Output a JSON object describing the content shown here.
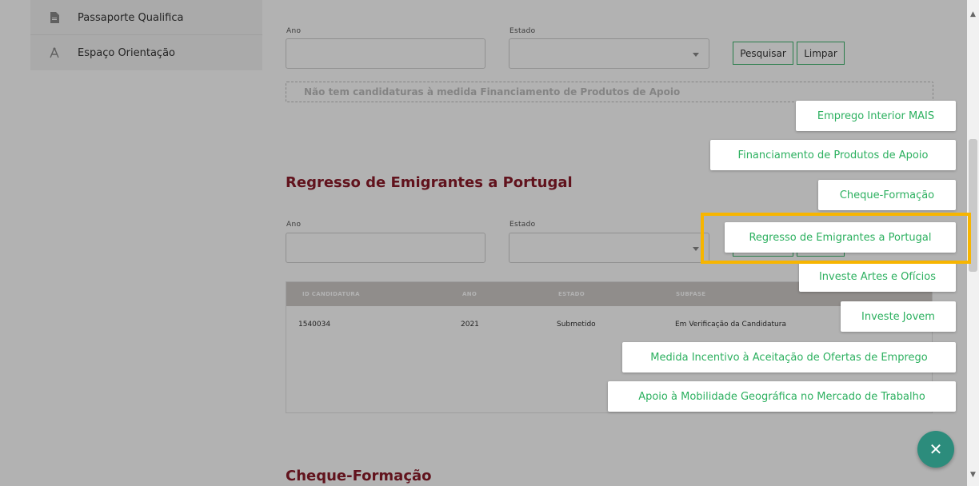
{
  "sidebar": {
    "items": [
      {
        "label": "Passaporte Qualifica",
        "icon": "document-icon"
      },
      {
        "label": "Espaço Orientação",
        "icon": "compass-icon"
      }
    ]
  },
  "search_top": {
    "ano_label": "Ano",
    "estado_label": "Estado",
    "search_button": "Pesquisar",
    "clear_button": "Limpar",
    "empty_message": "Não tem candidaturas à medida Financiamento de Produtos de Apoio"
  },
  "section_regresso": {
    "title": "Regresso de Emigrantes a Portugal",
    "ano_label": "Ano",
    "estado_label": "Estado",
    "table": {
      "headers": [
        "ID CANDIDATURA",
        "ANO",
        "ESTADO",
        "SUBFASE"
      ],
      "rows": [
        {
          "id": "1540034",
          "ano": "2021",
          "estado": "Submetido",
          "subfase": "Em Verificação da Candidatura"
        }
      ]
    }
  },
  "section_cheque": {
    "title": "Cheque-Formação"
  },
  "fab_menu": {
    "items": [
      "Emprego Interior MAIS",
      "Financiamento de Produtos de Apoio",
      "Cheque-Formação",
      "Regresso de Emigrantes a Portugal",
      "Investe Artes e Ofícios",
      "Investe Jovem",
      "Medida Incentivo à Aceitação de Ofertas de Emprego",
      "Apoio à Mobilidade Geográfica no Mercado de Trabalho"
    ],
    "highlighted_index": 3,
    "close_icon": "close-icon"
  },
  "colors": {
    "accent_green": "#2cb05f",
    "title_red": "#8b1c2a",
    "highlight": "#f7b500",
    "fab_teal": "#2c8c7c"
  }
}
